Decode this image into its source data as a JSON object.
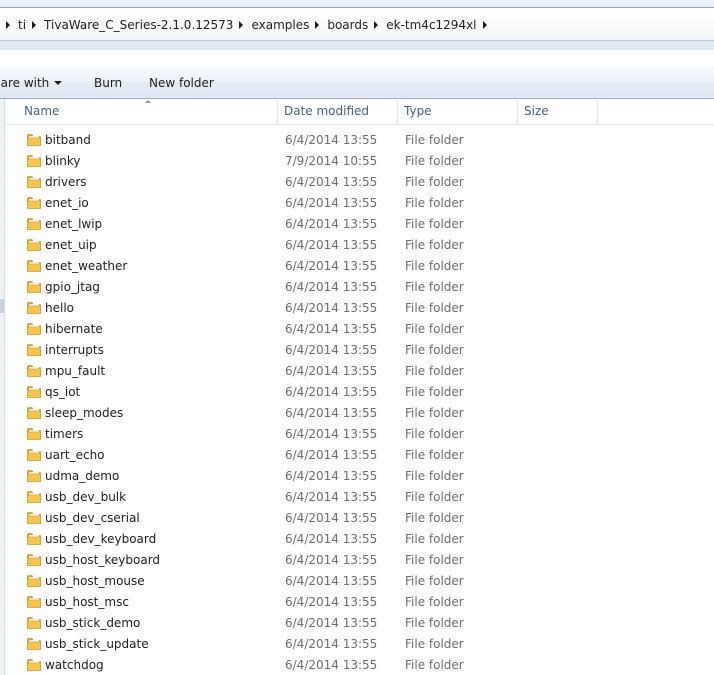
{
  "breadcrumb": [
    "ti",
    "TivaWare_C_Series-2.1.0.12573",
    "examples",
    "boards",
    "ek-tm4c1294xl"
  ],
  "toolbar": {
    "share_label": "hare with",
    "burn_label": "Burn",
    "new_folder_label": "New folder"
  },
  "columns": {
    "name": "Name",
    "date": "Date modified",
    "type": "Type",
    "size": "Size"
  },
  "files": [
    {
      "name": "bitband",
      "date": "6/4/2014 13:55",
      "type": "File folder"
    },
    {
      "name": "blinky",
      "date": "7/9/2014 10:55",
      "type": "File folder"
    },
    {
      "name": "drivers",
      "date": "6/4/2014 13:55",
      "type": "File folder"
    },
    {
      "name": "enet_io",
      "date": "6/4/2014 13:55",
      "type": "File folder"
    },
    {
      "name": "enet_lwip",
      "date": "6/4/2014 13:55",
      "type": "File folder"
    },
    {
      "name": "enet_uip",
      "date": "6/4/2014 13:55",
      "type": "File folder"
    },
    {
      "name": "enet_weather",
      "date": "6/4/2014 13:55",
      "type": "File folder"
    },
    {
      "name": "gpio_jtag",
      "date": "6/4/2014 13:55",
      "type": "File folder"
    },
    {
      "name": "hello",
      "date": "6/4/2014 13:55",
      "type": "File folder"
    },
    {
      "name": "hibernate",
      "date": "6/4/2014 13:55",
      "type": "File folder"
    },
    {
      "name": "interrupts",
      "date": "6/4/2014 13:55",
      "type": "File folder"
    },
    {
      "name": "mpu_fault",
      "date": "6/4/2014 13:55",
      "type": "File folder"
    },
    {
      "name": "qs_iot",
      "date": "6/4/2014 13:55",
      "type": "File folder"
    },
    {
      "name": "sleep_modes",
      "date": "6/4/2014 13:55",
      "type": "File folder"
    },
    {
      "name": "timers",
      "date": "6/4/2014 13:55",
      "type": "File folder"
    },
    {
      "name": "uart_echo",
      "date": "6/4/2014 13:55",
      "type": "File folder"
    },
    {
      "name": "udma_demo",
      "date": "6/4/2014 13:55",
      "type": "File folder"
    },
    {
      "name": "usb_dev_bulk",
      "date": "6/4/2014 13:55",
      "type": "File folder"
    },
    {
      "name": "usb_dev_cserial",
      "date": "6/4/2014 13:55",
      "type": "File folder"
    },
    {
      "name": "usb_dev_keyboard",
      "date": "6/4/2014 13:55",
      "type": "File folder"
    },
    {
      "name": "usb_host_keyboard",
      "date": "6/4/2014 13:55",
      "type": "File folder"
    },
    {
      "name": "usb_host_mouse",
      "date": "6/4/2014 13:55",
      "type": "File folder"
    },
    {
      "name": "usb_host_msc",
      "date": "6/4/2014 13:55",
      "type": "File folder"
    },
    {
      "name": "usb_stick_demo",
      "date": "6/4/2014 13:55",
      "type": "File folder"
    },
    {
      "name": "usb_stick_update",
      "date": "6/4/2014 13:55",
      "type": "File folder"
    },
    {
      "name": "watchdog",
      "date": "6/4/2014 13:55",
      "type": "File folder"
    }
  ],
  "icons": {
    "folder": "folder-icon",
    "breadcrumb_separator": "chevron-right-icon",
    "dropdown": "chevron-down-icon",
    "sort": "sort-ascending-icon"
  },
  "colors": {
    "folder_body": "#f4c650",
    "folder_dark": "#d9a21f",
    "column_header_text": "#4c607a",
    "secondary_text": "#6d6d6d"
  }
}
